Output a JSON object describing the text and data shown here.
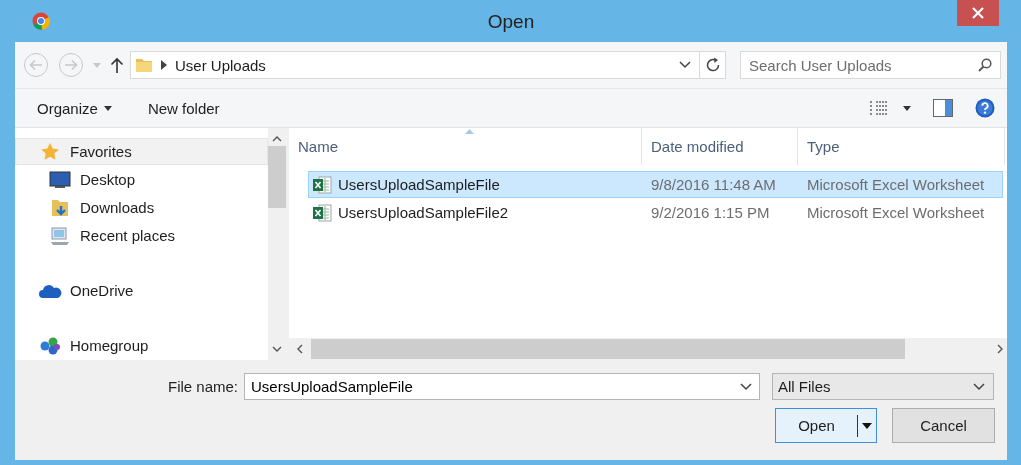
{
  "window": {
    "title": "Open"
  },
  "nav": {
    "path": "User Uploads",
    "search_placeholder": "Search User Uploads"
  },
  "toolbar": {
    "organize": "Organize",
    "new_folder": "New folder"
  },
  "sidebar": {
    "items": [
      {
        "label": "Favorites",
        "selected": true,
        "children": [
          {
            "label": "Desktop",
            "selected": false
          },
          {
            "label": "Downloads",
            "selected": false
          },
          {
            "label": "Recent places",
            "selected": false
          }
        ]
      },
      {
        "label": "OneDrive",
        "selected": false
      },
      {
        "label": "Homegroup",
        "selected": false
      }
    ]
  },
  "file_list": {
    "columns": [
      {
        "label": "Name",
        "sorted": true
      },
      {
        "label": "Date modified",
        "sorted": false
      },
      {
        "label": "Type",
        "sorted": false
      }
    ],
    "rows": [
      {
        "name": "UsersUploadSampleFile",
        "date": "9/8/2016 11:48 AM",
        "type": "Microsoft Excel Worksheet",
        "selected": true
      },
      {
        "name": "UsersUploadSampleFile2",
        "date": "9/2/2016 1:15 PM",
        "type": "Microsoft Excel Worksheet",
        "selected": false
      }
    ]
  },
  "footer": {
    "file_name_label": "File name:",
    "file_name": "UsersUploadSampleFile",
    "file_type": "All Files",
    "open": "Open",
    "cancel": "Cancel"
  }
}
